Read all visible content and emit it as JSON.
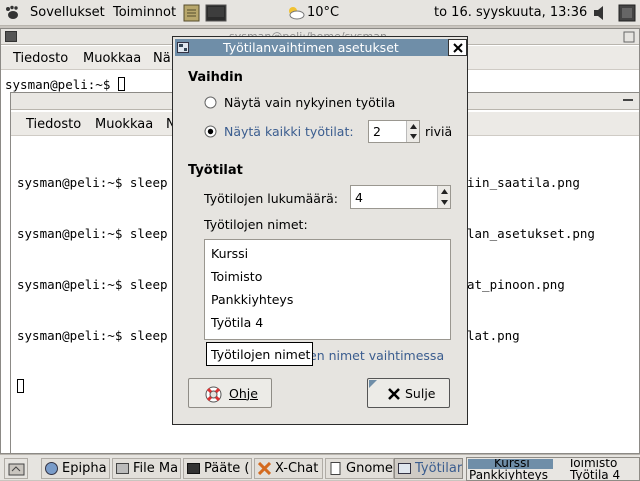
{
  "top_panel": {
    "applications": "Sovellukset",
    "actions": "Toiminnot",
    "weather": "10°C",
    "clock": "to 16. syyskuuta, 13:36"
  },
  "terminal_back": {
    "title": "sysman@peli:/home/sysman",
    "menu": [
      "Tiedosto",
      "Muokkaa",
      "Nä"
    ],
    "prompt": "sysman@peli:~$ "
  },
  "terminal_front": {
    "menu": [
      "Tiedosto",
      "Muokkaa",
      "N"
    ],
    "lines": [
      "sysman@peli:~$ sleep",
      "sysman@peli:~$ sleep",
      "sysman@peli:~$ sleep",
      "sysman@peli:~$ sleep"
    ],
    "right_fragments": [
      "iin_saatila.png",
      "lan_asetukset.png",
      "at_pinoon.png",
      "lat.png"
    ]
  },
  "dialog": {
    "title": "Työtilanvaihtimen asetukset",
    "switcher": {
      "heading": "Vaihdin",
      "option_current": "Näytä vain nykyinen työtila",
      "option_all": "Näytä kaikki työtilat:",
      "rows_value": "2",
      "rows_unit": "riviä"
    },
    "workspaces": {
      "heading": "Työtilat",
      "count_label": "Työtilojen lukumäärä:",
      "count_value": "4",
      "names_label": "Työtilojen nimet:",
      "names": [
        "Kurssi",
        "Toimisto",
        "Pankkiyhteys",
        "Työtila 4"
      ],
      "tooltip": "Työtilojen nimet",
      "partial_link": "en nimet vaihtimessa"
    },
    "help_button": "Ohje",
    "close_button": "Sulje"
  },
  "taskbar": {
    "tasks": [
      "Epipha",
      "File Ma",
      "Pääte (",
      "X-Chat",
      "Gnome",
      "Työtilar"
    ],
    "pager": [
      "Kurssi",
      "Toimisto",
      "Pankkiyhteys",
      "Työtila 4"
    ]
  },
  "colors": {
    "title_active": "#6f8ea8",
    "link_blue": "#3b5d8f",
    "panel_bg": "#e6e4e0"
  }
}
